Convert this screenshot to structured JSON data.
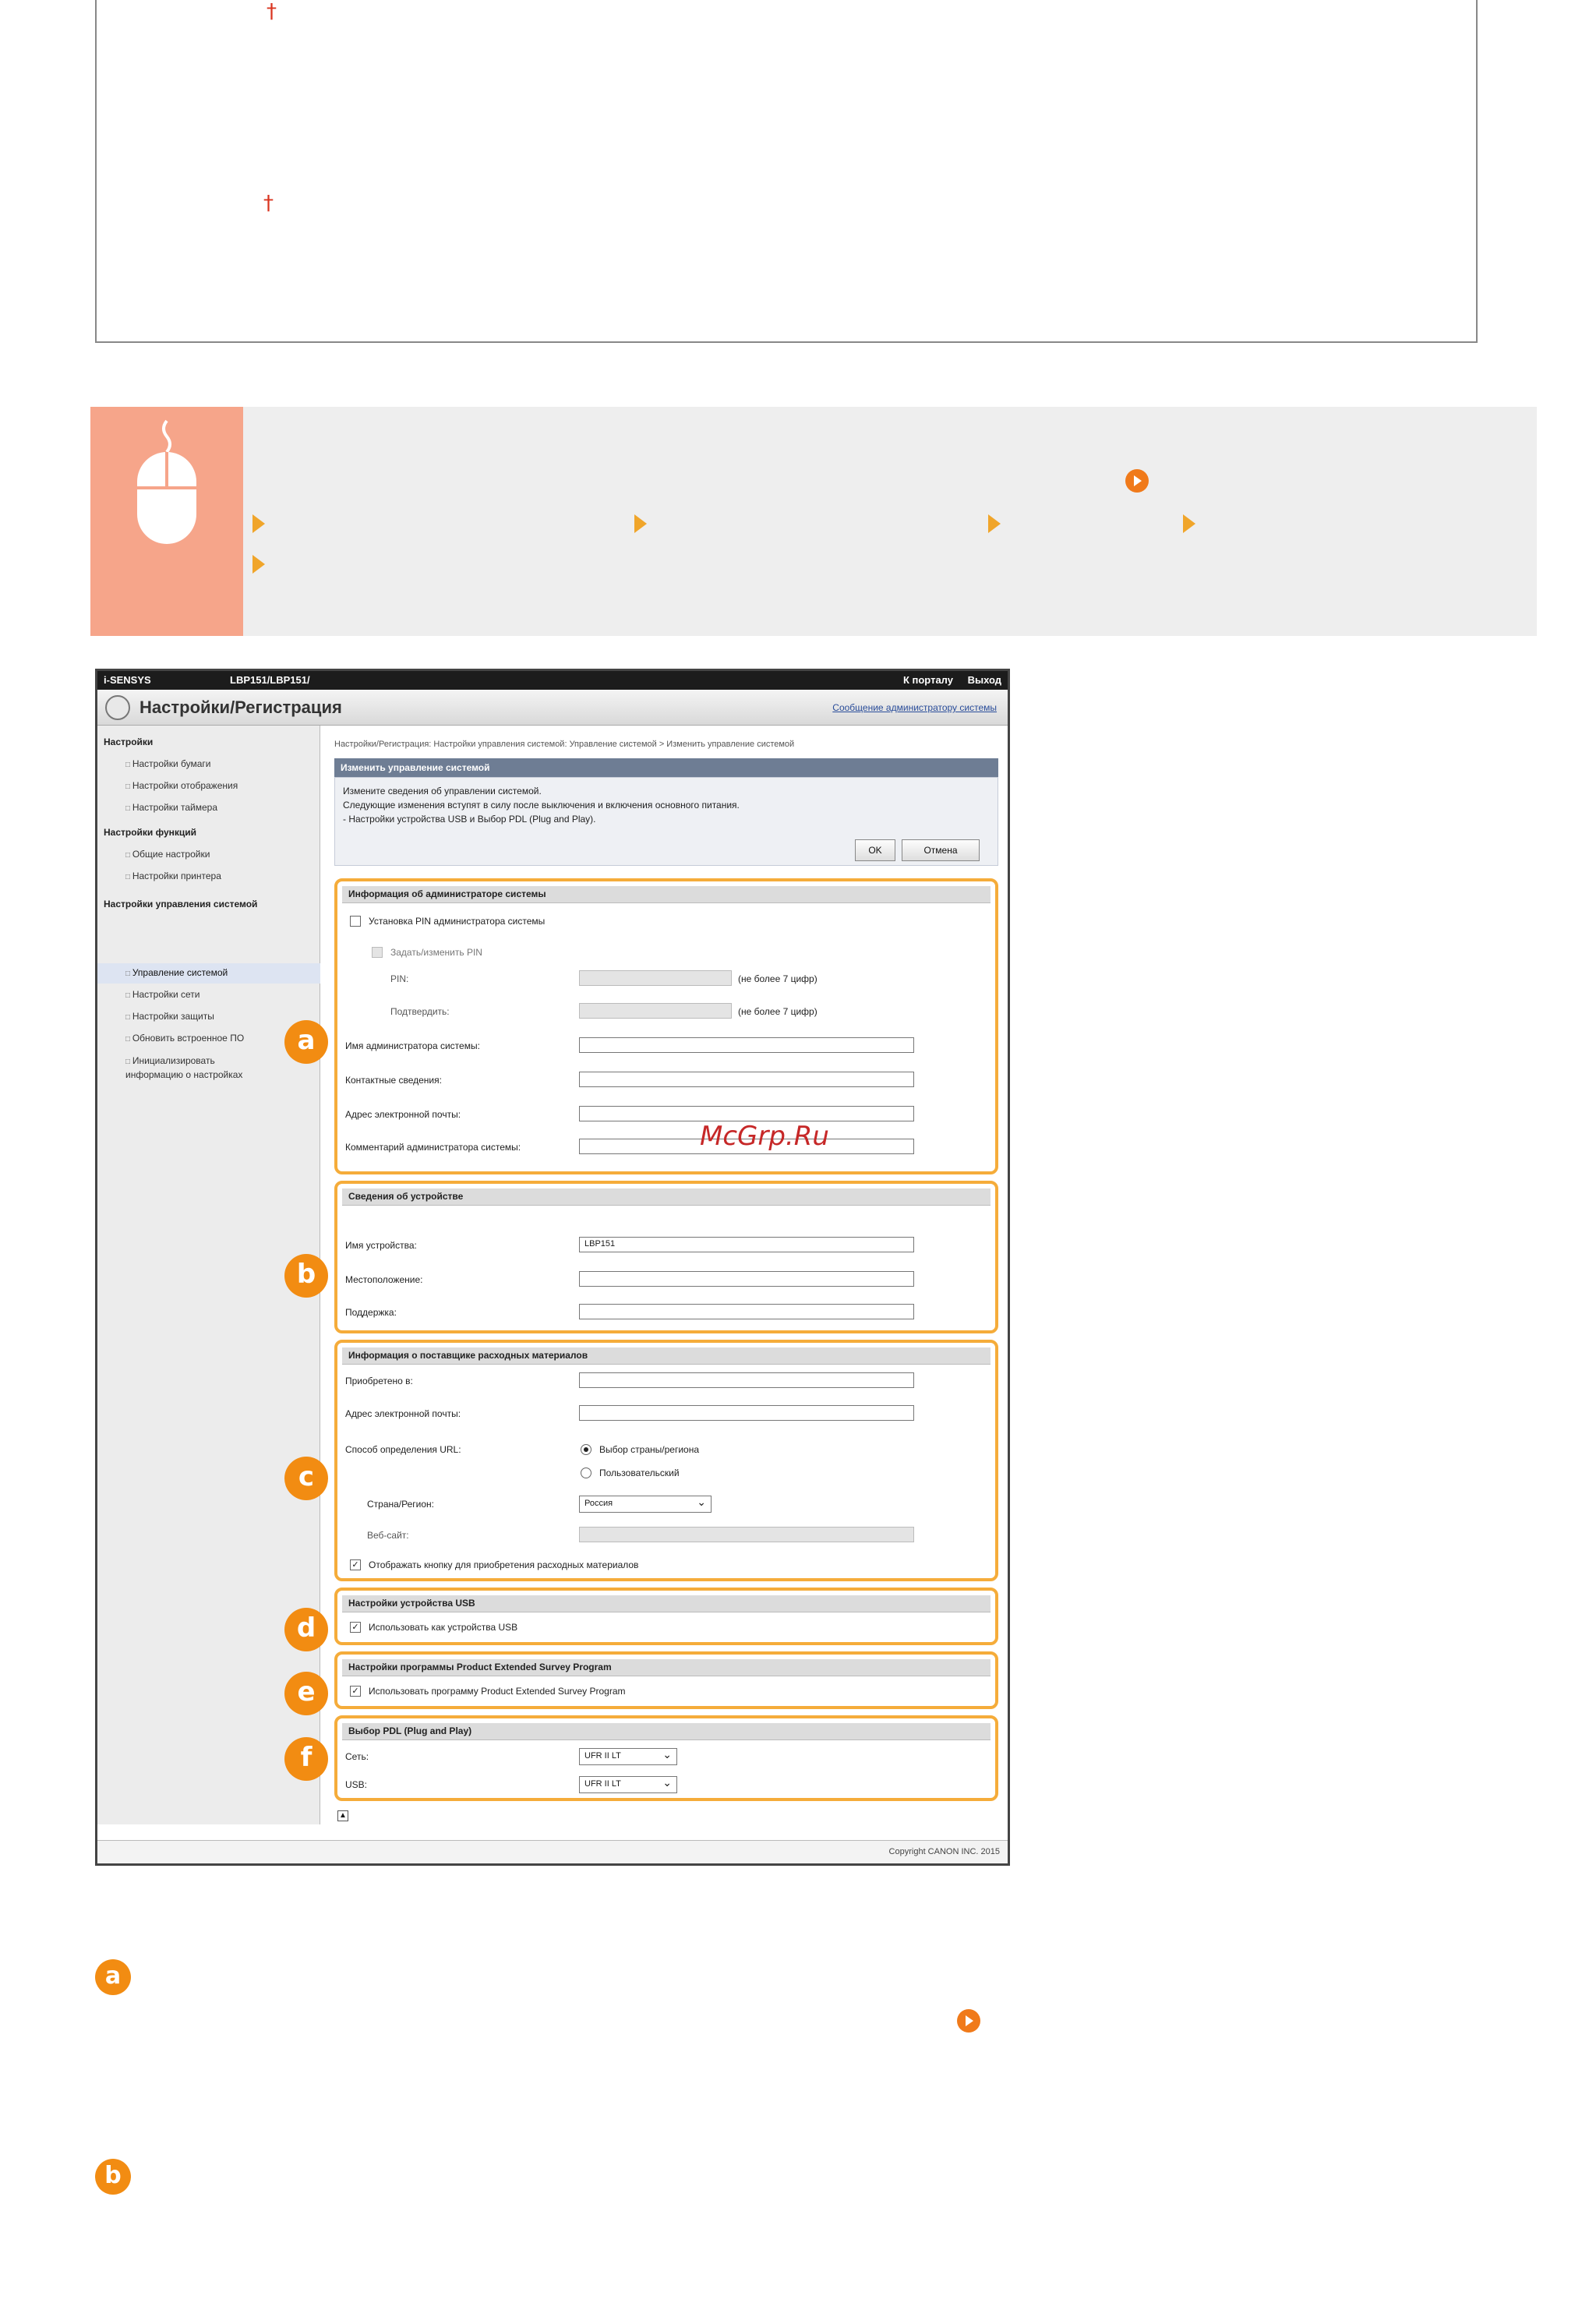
{
  "page": {
    "dagger_symbol": "†"
  },
  "screenshot": {
    "product": "i-SENSYS",
    "model": "LBP151/LBP151/",
    "top_links": {
      "portal": "К порталу",
      "logout": "Выход"
    },
    "page_title": "Настройки/Регистрация",
    "admin_message_link": "Сообщение администратору системы",
    "sidebar": {
      "sec_settings": "Настройки",
      "items_settings": [
        "Настройки бумаги",
        "Настройки отображения",
        "Настройки таймера"
      ],
      "sec_functions": "Настройки функций",
      "items_functions": [
        "Общие настройки",
        "Настройки принтера"
      ],
      "sec_system": "Настройки управления системой",
      "items_system": [
        "Управление системой",
        "Настройки сети",
        "Настройки защиты",
        "Обновить встроенное ПО",
        "Инициализировать информацию о настройках"
      ]
    },
    "breadcrumb": "Настройки/Регистрация: Настройки управления системой: Управление системой > Изменить управление системой",
    "panel": {
      "title": "Изменить управление системой",
      "line1": "Измените сведения об управлении системой.",
      "line2": "Следующие изменения вступят в силу после выключения и включения основного питания.",
      "line3": "- Настройки устройства USB и Выбор PDL (Plug and Play).",
      "ok": "OK",
      "cancel": "Отмена"
    },
    "admin_info": {
      "title": "Информация об администраторе системы",
      "set_pin": "Установка PIN администратора системы",
      "change_pin": "Задать/изменить PIN",
      "pin": "PIN:",
      "confirm": "Подтвердить:",
      "pin_hint": "(не более 7 цифр)",
      "name": "Имя администратора системы:",
      "contact": "Контактные сведения:",
      "email": "Адрес электронной почты:",
      "comment": "Комментарий администратора системы:"
    },
    "device_info": {
      "title": "Сведения об устройстве",
      "name": "Имя устройства:",
      "name_value": "LBP151",
      "location": "Местоположение:",
      "support": "Поддержка:"
    },
    "supplier_info": {
      "title": "Информация о поставщике расходных материалов",
      "purchased": "Приобретено в:",
      "email": "Адрес электронной почты:",
      "url_method": "Способ определения URL:",
      "opt_region": "Выбор страны/региона",
      "opt_custom": "Пользовательский",
      "country": "Страна/Регион:",
      "country_value": "Россия",
      "website": "Веб-сайт:",
      "show_button": "Отображать кнопку для приобретения расходных материалов"
    },
    "usb": {
      "title": "Настройки устройства USB",
      "use": "Использовать как устройства USB"
    },
    "survey": {
      "title": "Настройки программы Product Extended Survey Program",
      "use": "Использовать программу Product Extended Survey Program"
    },
    "pdl": {
      "title": "Выбор PDL (Plug and Play)",
      "network": "Сеть:",
      "usb": "USB:",
      "network_value": "UFR II LT",
      "usb_value": "UFR II LT"
    },
    "copyright": "Copyright CANON INC. 2015",
    "badges": [
      "a",
      "b",
      "c",
      "d",
      "e",
      "f"
    ]
  },
  "watermark": "McGrp.Ru",
  "legend_badges": [
    "a",
    "b"
  ]
}
